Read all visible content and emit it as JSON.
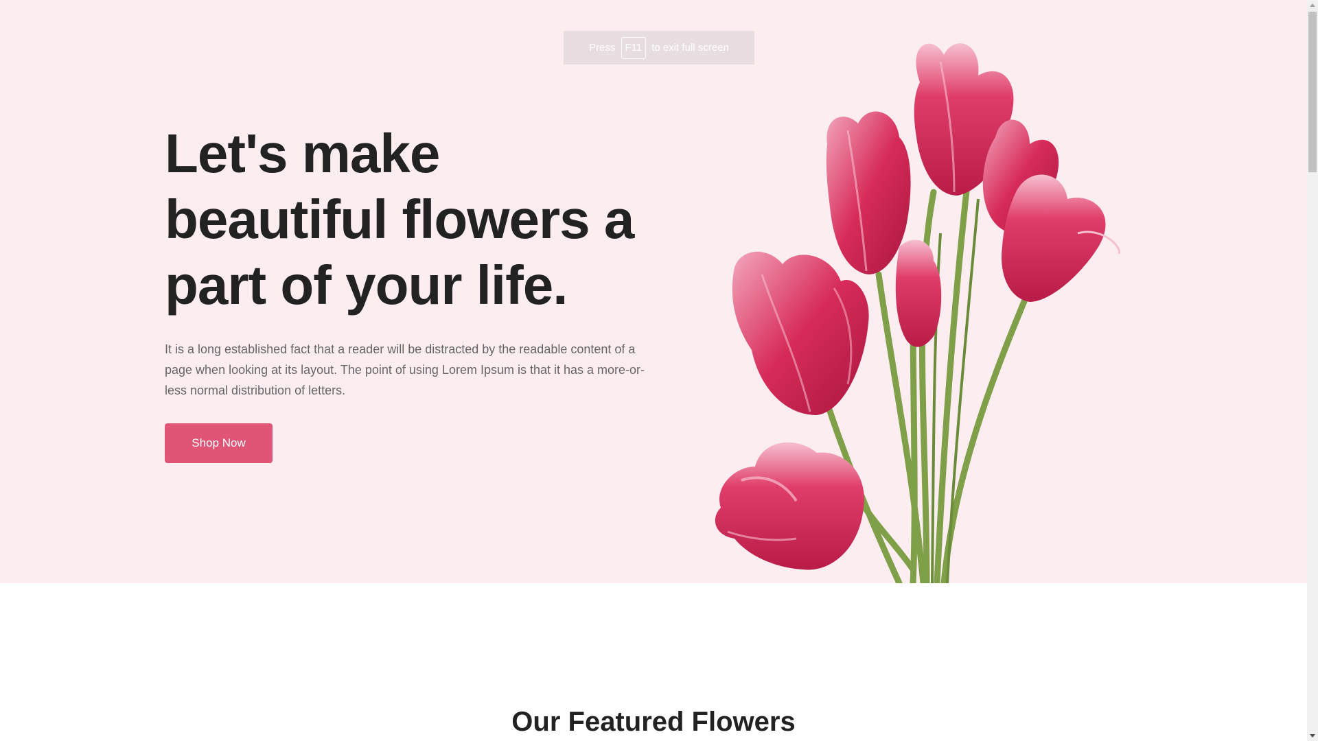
{
  "hero": {
    "title_lines": [
      "Let's make",
      "beautiful flowers a",
      "part of your life."
    ],
    "description": "It is a long established fact that a reader will be distracted by the readable content of a page when looking at its layout. The point of using Lorem Ipsum is that it has a more-or-less normal distribution of letters.",
    "cta_label": "Shop Now"
  },
  "fullscreen_notice": {
    "prefix": "Press",
    "key": "F11",
    "suffix": "to exit full screen"
  },
  "featured": {
    "title": "Our Featured Flowers"
  },
  "colors": {
    "hero_background": "#fcedf0",
    "accent": "#e05575",
    "heading": "#222222",
    "body_text": "#666666",
    "tulip_petal": "#d42a58",
    "tulip_highlight": "#f6bfd0",
    "stem": "#7fa048"
  },
  "icons": [
    "tulip-bouquet-image",
    "scroll-up-arrow-icon",
    "scroll-down-arrow-icon"
  ]
}
